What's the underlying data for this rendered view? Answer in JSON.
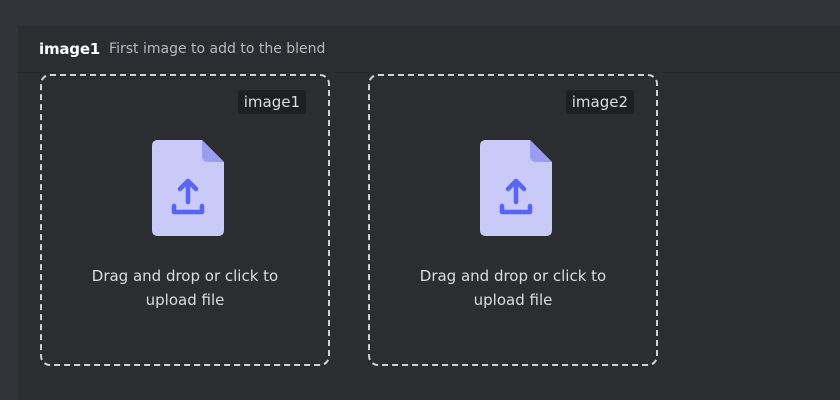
{
  "header": {
    "param_name": "image1",
    "param_description": "First image to add to the blend"
  },
  "dropzones": [
    {
      "tag": "image1",
      "text_line1": "Drag and drop or click to",
      "text_line2": "upload file",
      "icon": "file-upload-icon"
    },
    {
      "tag": "image2",
      "text_line1": "Drag and drop or click to",
      "text_line2": "upload file",
      "icon": "file-upload-icon"
    }
  ],
  "colors": {
    "background": "#313338",
    "panel": "#2b2d31",
    "icon_page": "#c9caf8",
    "icon_fold": "#9b9df0",
    "icon_arrow": "#5865f2"
  }
}
